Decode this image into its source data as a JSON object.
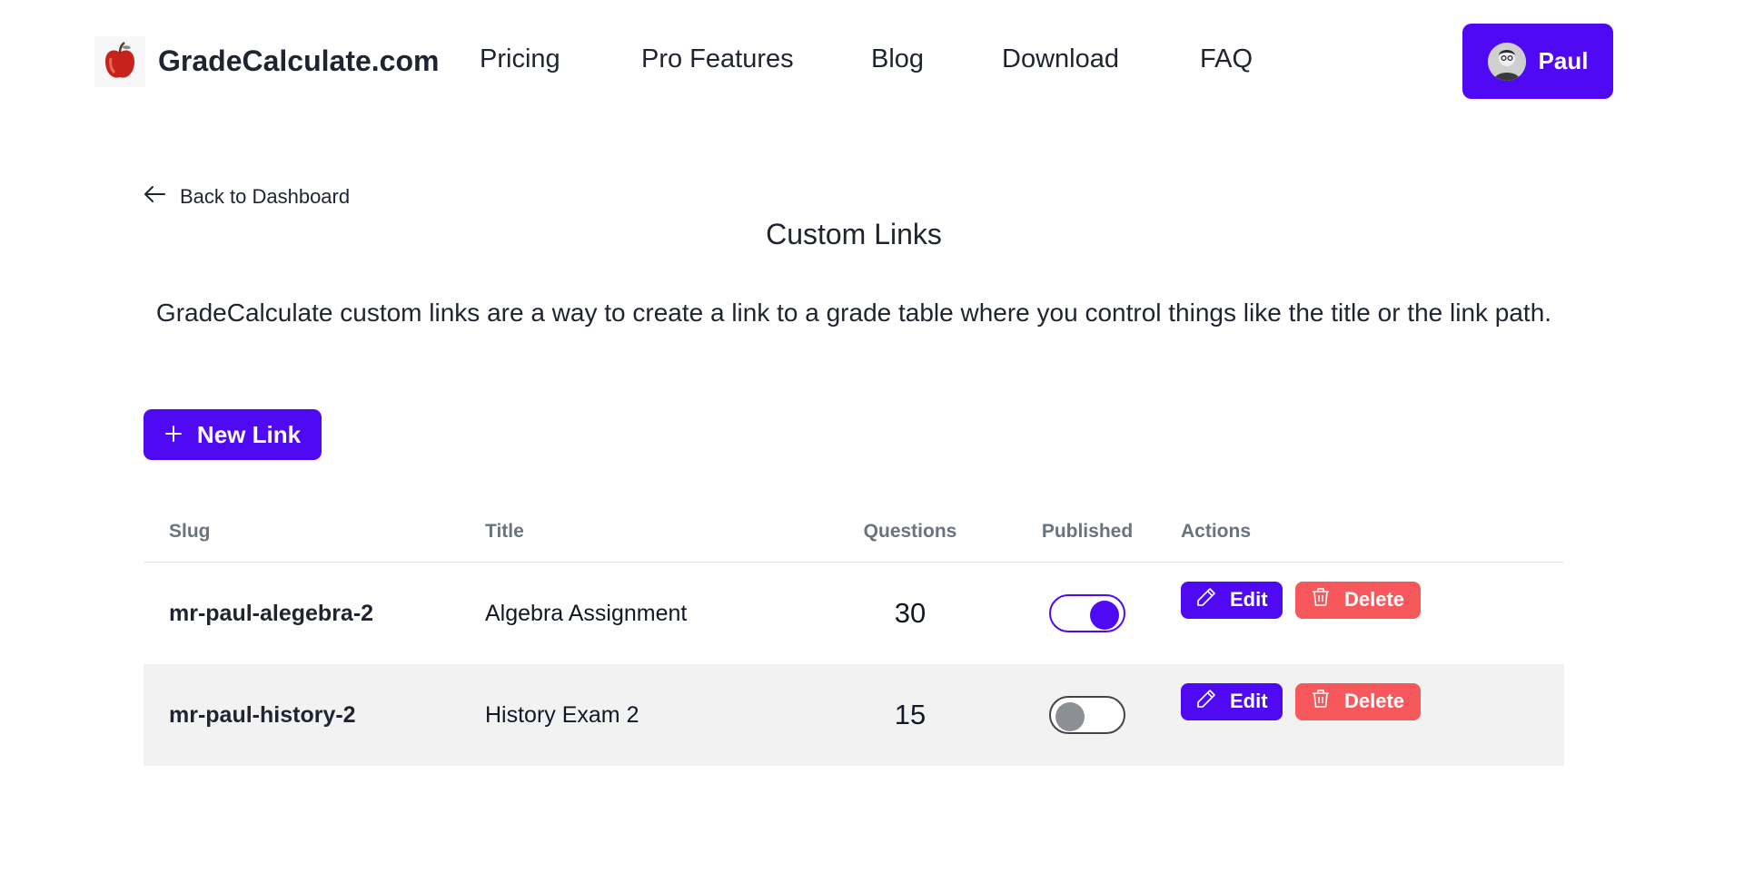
{
  "header": {
    "brand": "GradeCalculate.com",
    "nav": [
      "Pricing",
      "Pro Features",
      "Blog",
      "Download",
      "FAQ"
    ],
    "user_name": "Paul",
    "accent": "#4f0af3"
  },
  "main": {
    "back_label": "Back to Dashboard",
    "title": "Custom Links",
    "description": "GradeCalculate custom links are a way to create a link to a grade table where you control things like the title or the link path.",
    "new_link_label": "New Link"
  },
  "table": {
    "headers": [
      "Slug",
      "Title",
      "Questions",
      "Published",
      "Actions"
    ],
    "rows": [
      {
        "slug": "mr-paul-alegebra-2",
        "title": "Algebra Assignment",
        "questions": "30",
        "published": true
      },
      {
        "slug": "mr-paul-history-2",
        "title": "History Exam 2",
        "questions": "15",
        "published": false
      }
    ],
    "edit_label": "Edit",
    "delete_label": "Delete",
    "delete_color": "#f6585c"
  }
}
